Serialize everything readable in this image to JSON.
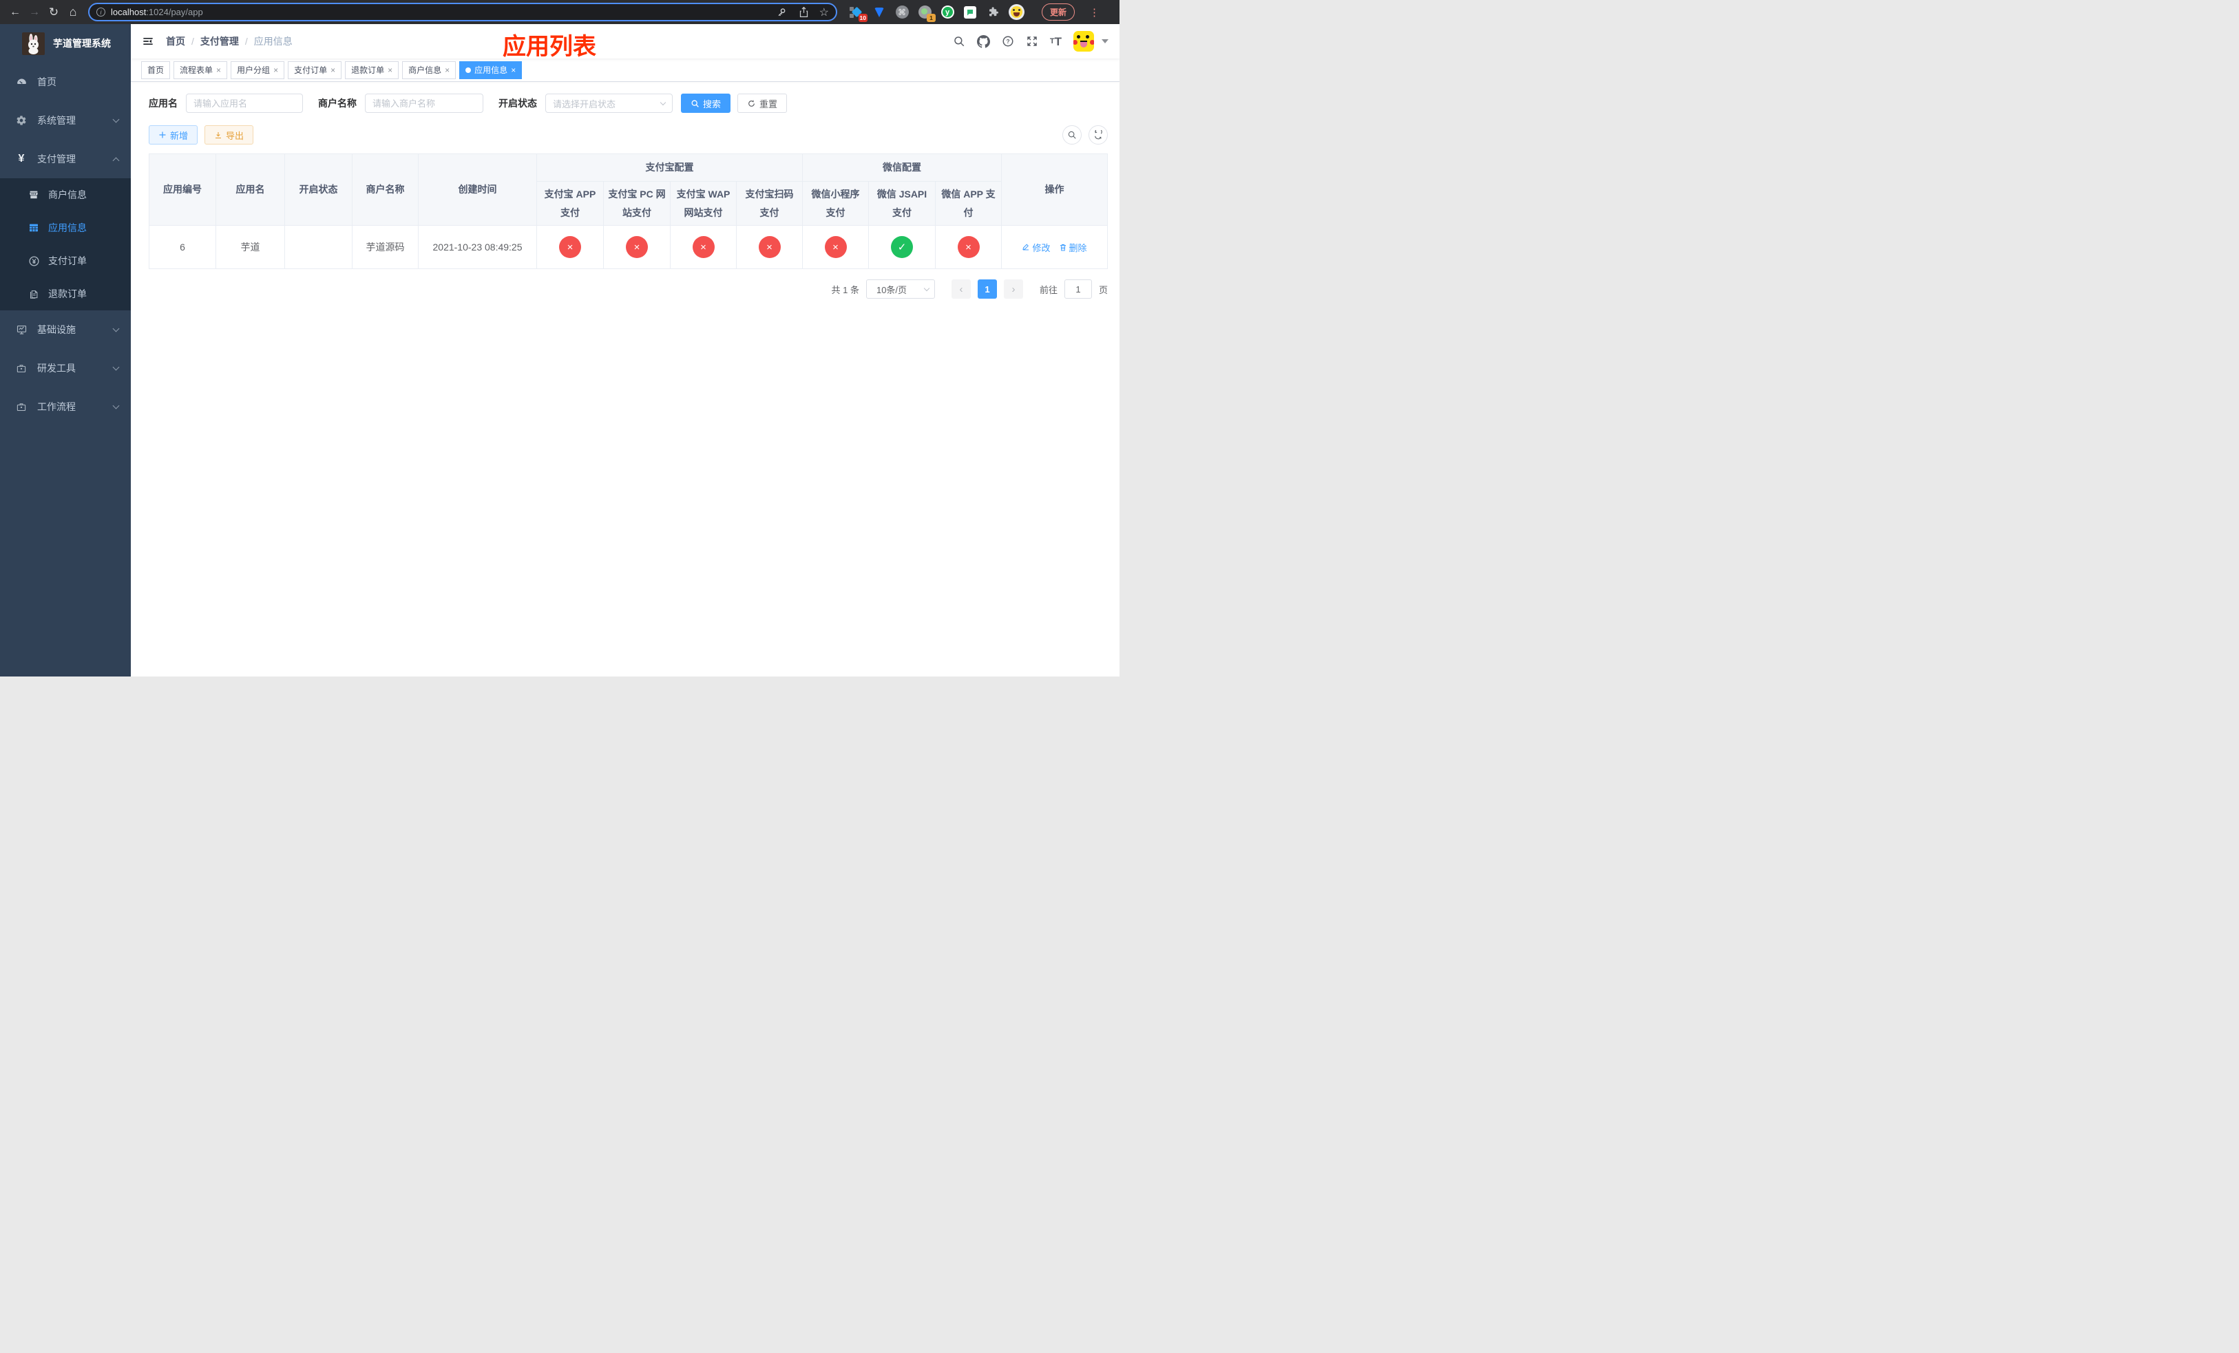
{
  "browser": {
    "url_host": "localhost",
    "url_rest": ":1024/pay/app",
    "ext_badge_red": "10",
    "ext_badge_orange": "1",
    "ext_y_letter": "y",
    "update_label": "更新"
  },
  "sidebar": {
    "title": "芋道管理系统",
    "items": {
      "home": "首页",
      "system": "系统管理",
      "payment": "支付管理",
      "merchant": "商户信息",
      "appinfo": "应用信息",
      "payorder": "支付订单",
      "refund": "退款订单",
      "infra": "基础设施",
      "devtool": "研发工具",
      "workflow": "工作流程"
    }
  },
  "navbar": {
    "breadcrumb": {
      "home": "首页",
      "section": "支付管理",
      "current": "应用信息"
    },
    "overlay_title": "应用列表"
  },
  "tabs": [
    {
      "label": "首页",
      "closable": false,
      "active": false
    },
    {
      "label": "流程表单",
      "closable": true,
      "active": false
    },
    {
      "label": "用户分组",
      "closable": true,
      "active": false
    },
    {
      "label": "支付订单",
      "closable": true,
      "active": false
    },
    {
      "label": "退款订单",
      "closable": true,
      "active": false
    },
    {
      "label": "商户信息",
      "closable": true,
      "active": false
    },
    {
      "label": "应用信息",
      "closable": true,
      "active": true
    }
  ],
  "filters": {
    "app_name_label": "应用名",
    "app_name_placeholder": "请输入应用名",
    "merchant_label": "商户名称",
    "merchant_placeholder": "请输入商户名称",
    "status_label": "开启状态",
    "status_placeholder": "请选择开启状态",
    "search_label": "搜索",
    "reset_label": "重置"
  },
  "toolbar": {
    "add_label": "新增",
    "export_label": "导出"
  },
  "table": {
    "columns": {
      "id": "应用编号",
      "name": "应用名",
      "enabled": "开启状态",
      "merchant": "商户名称",
      "created": "创建时间",
      "action": "操作"
    },
    "groups": {
      "alipay": "支付宝配置",
      "wechat": "微信配置"
    },
    "sub_columns": [
      "支付宝 APP 支付",
      "支付宝 PC 网站支付",
      "支付宝 WAP 网站支付",
      "支付宝扫码支付",
      "微信小程序支付",
      "微信 JSAPI 支付",
      "微信 APP 支付"
    ],
    "row": {
      "id": "6",
      "name": "芋道",
      "enabled": true,
      "merchant": "芋道源码",
      "created": "2021-10-23 08:49:25",
      "statuses": [
        false,
        false,
        false,
        false,
        false,
        true,
        false
      ],
      "edit_label": "修改",
      "delete_label": "删除"
    }
  },
  "pagination": {
    "total": "共 1 条",
    "per_page": "10条/页",
    "page": "1",
    "goto_label": "前往",
    "goto_value": "1",
    "page_unit": "页"
  },
  "colors": {
    "primary": "#409EFF",
    "danger": "#f4504e",
    "success": "#1ec15f",
    "title_red": "#ff3000",
    "sidebar_bg": "#304156",
    "submenu_bg": "#1f2d3d"
  }
}
